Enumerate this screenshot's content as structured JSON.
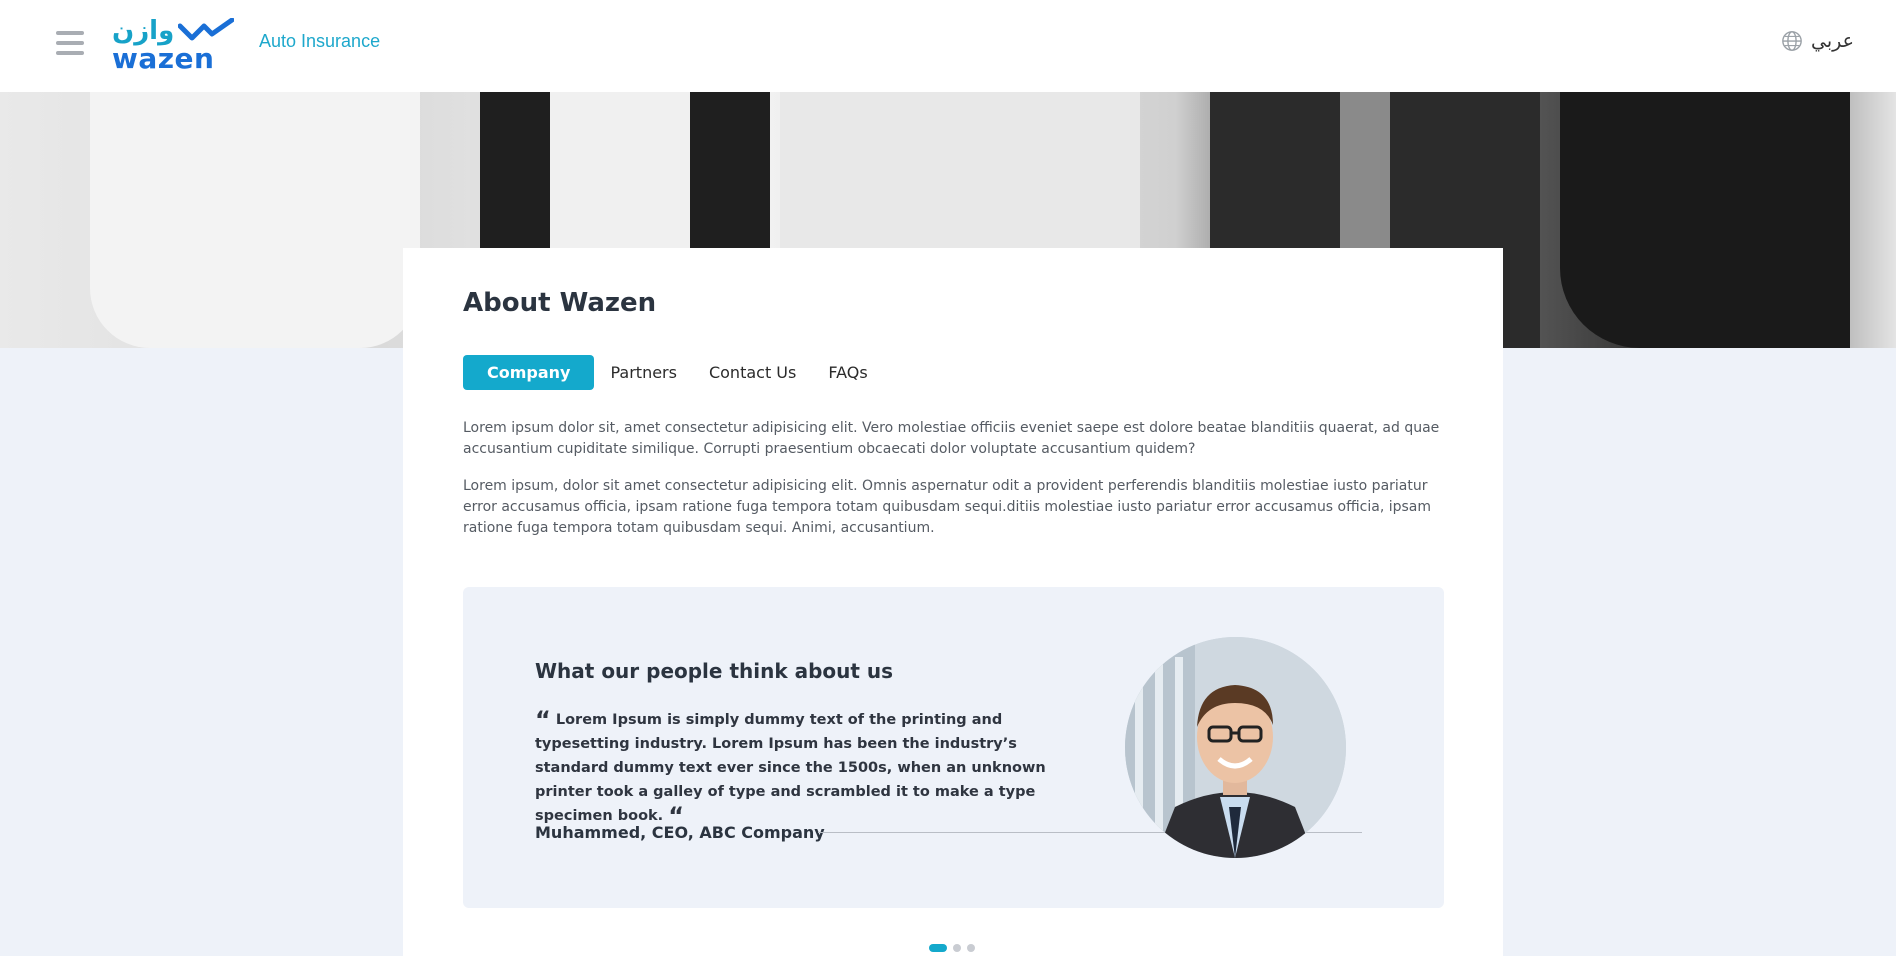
{
  "header": {
    "logo_ar": "وازن",
    "logo_en": "wazen",
    "product": "Auto Insurance",
    "language": "عربي",
    "menu_icon": "hamburger-icon",
    "globe_icon": "globe-icon"
  },
  "main": {
    "title": "About Wazen",
    "tabs": [
      {
        "label": "Company",
        "active": true
      },
      {
        "label": "Partners",
        "active": false
      },
      {
        "label": "Contact Us",
        "active": false
      },
      {
        "label": "FAQs",
        "active": false
      }
    ],
    "paragraphs": [
      "Lorem ipsum dolor sit, amet consectetur adipisicing elit. Vero molestiae officiis eveniet saepe est dolore beatae blanditiis quaerat, ad quae accusantium cupiditate similique. Corrupti praesentium obcaecati dolor voluptate accusantium quidem?",
      "Lorem ipsum, dolor sit amet consectetur adipisicing elit. Omnis aspernatur odit a provident perferendis blanditiis molestiae iusto pariatur error accusamus officia, ipsam ratione fuga tempora totam quibusdam sequi.ditiis molestiae iusto pariatur error accusamus officia, ipsam ratione fuga tempora totam quibusdam sequi. Animi, accusantium."
    ]
  },
  "testimonial": {
    "heading": "What our people think about us",
    "quote_mark": "“",
    "quote": "Lorem Ipsum is simply dummy text of the printing and typesetting industry. Lorem Ipsum has been the industry’s standard dummy text ever since the 1500s, when an unknown printer took a galley of type and scrambled it to make a type specimen book.",
    "author": "Muhammed, CEO, ABC Company"
  },
  "carousel": {
    "count": 3,
    "active_index": 0
  },
  "colors": {
    "accent": "#14a9cc",
    "brand_blue": "#1a6fd6",
    "background": "#eef2f9"
  }
}
